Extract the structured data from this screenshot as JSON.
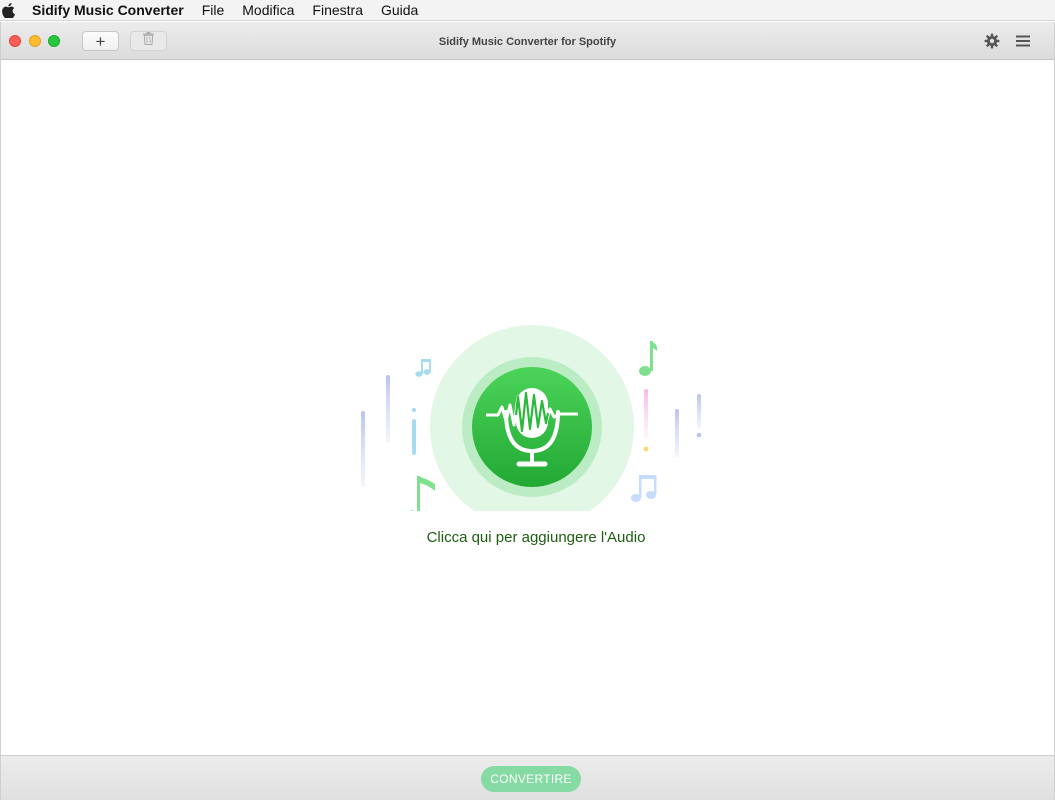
{
  "menubar": {
    "apple_icon": "apple-icon",
    "app_name": "Sidify Music Converter",
    "items": [
      "File",
      "Modifica",
      "Finestra",
      "Guida"
    ]
  },
  "window": {
    "title": "Sidify Music Converter for Spotify",
    "toolbar": {
      "add_label": "+",
      "delete_icon": "trash-icon",
      "settings_icon": "gear-icon",
      "menu_icon": "hamburger-menu-icon"
    }
  },
  "main": {
    "add_audio_label": "Clicca qui per aggiungere l'Audio",
    "illustration_icon": "microphone-waveform-icon"
  },
  "footer": {
    "convert_label": "CONVERTIRE"
  },
  "colors": {
    "accent_green": "#2db83d",
    "convert_button": "#85dba3",
    "label_green": "#1c5e10"
  }
}
